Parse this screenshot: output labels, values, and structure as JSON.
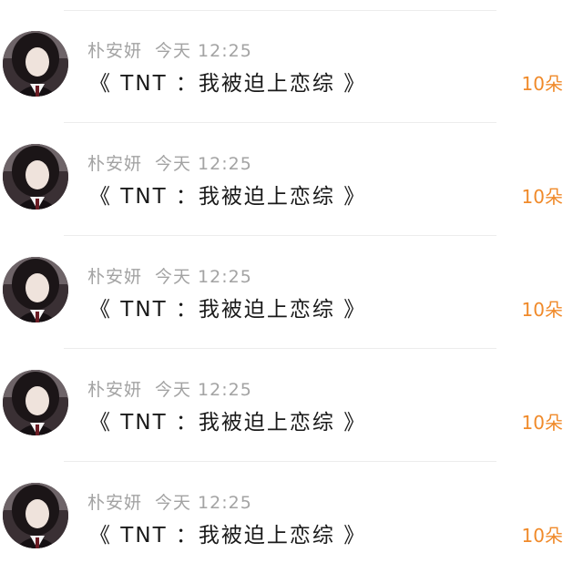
{
  "feed": {
    "items": [
      {
        "user": "朴安妍",
        "time": "今天 12:25",
        "title": "《 TNT ：我被迫上恋综 》",
        "amount": "10朵"
      },
      {
        "user": "朴安妍",
        "time": "今天 12:25",
        "title": "《 TNT ：我被迫上恋综 》",
        "amount": "10朵"
      },
      {
        "user": "朴安妍",
        "time": "今天 12:25",
        "title": "《 TNT ：我被迫上恋综 》",
        "amount": "10朵"
      },
      {
        "user": "朴安妍",
        "time": "今天 12:25",
        "title": "《 TNT ：我被迫上恋综 》",
        "amount": "10朵"
      },
      {
        "user": "朴安妍",
        "time": "今天 12:25",
        "title": "《 TNT ：我被迫上恋综 》",
        "amount": "10朵"
      }
    ]
  },
  "colors": {
    "meta_text": "#a3a3a3",
    "title_text": "#1a1a1a",
    "amount_text": "#f08a2a",
    "divider": "#ececec"
  }
}
